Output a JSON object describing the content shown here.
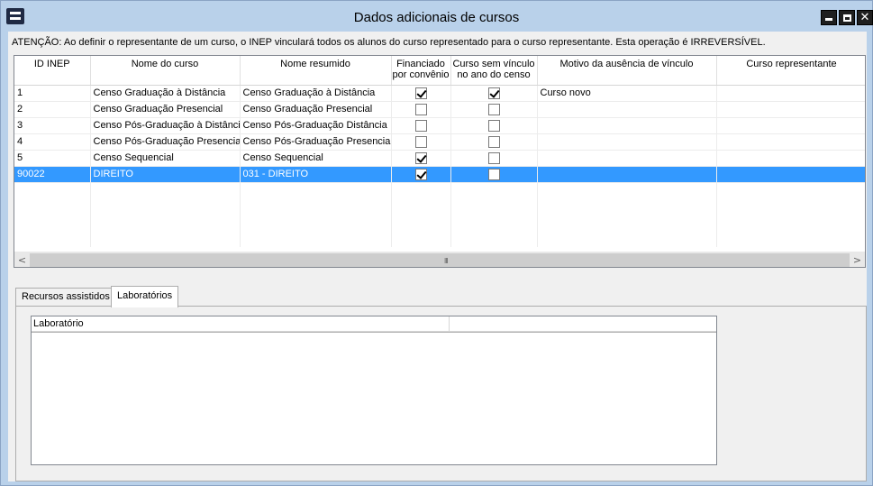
{
  "window": {
    "title": "Dados adicionais de cursos"
  },
  "warning": "ATENÇÃO: Ao definir o representante de um curso, o INEP vinculará todos os alunos do curso representado para o curso representante. Esta operação é IRREVERSÍVEL.",
  "grid": {
    "columns": [
      "ID INEP",
      "Nome do curso",
      "Nome resumido",
      "Financiado por convênio",
      "Curso sem vínculo no ano do censo",
      "Motivo da ausência de vínculo",
      "Curso representante"
    ],
    "rows": [
      {
        "id": "1",
        "nome": "Censo Graduação à Distância",
        "resumido": "Censo Graduação à Distância",
        "financiado": true,
        "sem_vinculo": true,
        "motivo": "Curso novo",
        "representante": ""
      },
      {
        "id": "2",
        "nome": "Censo Graduação Presencial",
        "resumido": "Censo Graduação Presencial",
        "financiado": false,
        "sem_vinculo": false,
        "motivo": "",
        "representante": ""
      },
      {
        "id": "3",
        "nome": "Censo Pós-Graduação à Distância",
        "resumido": "Censo Pós-Graduação Distância",
        "financiado": false,
        "sem_vinculo": false,
        "motivo": "",
        "representante": ""
      },
      {
        "id": "4",
        "nome": "Censo Pós-Graduação Presencial",
        "resumido": "Censo Pós-Graduação Presencial",
        "financiado": false,
        "sem_vinculo": false,
        "motivo": "",
        "representante": ""
      },
      {
        "id": "5",
        "nome": "Censo Sequencial",
        "resumido": "Censo Sequencial",
        "financiado": true,
        "sem_vinculo": false,
        "motivo": "",
        "representante": ""
      },
      {
        "id": "90022",
        "nome": "DIREITO",
        "resumido": "031 - DIREITO",
        "financiado": true,
        "sem_vinculo": false,
        "motivo": "",
        "representante": "",
        "selected": true
      }
    ]
  },
  "scrollbar": {
    "left_arrow": "<",
    "right_arrow": ">",
    "grip": "III"
  },
  "tabs": [
    {
      "label": "Recursos assistidos",
      "active": false
    },
    {
      "label": "Laboratórios",
      "active": true
    }
  ],
  "lab_grid": {
    "column": "Laboratório"
  },
  "icons": {
    "app": "app-icon",
    "minimize": "minimize-icon",
    "maximize": "maximize-icon",
    "close": "close-icon"
  },
  "colors": {
    "window_frame": "#b9d1ea",
    "selection": "#3399ff"
  }
}
